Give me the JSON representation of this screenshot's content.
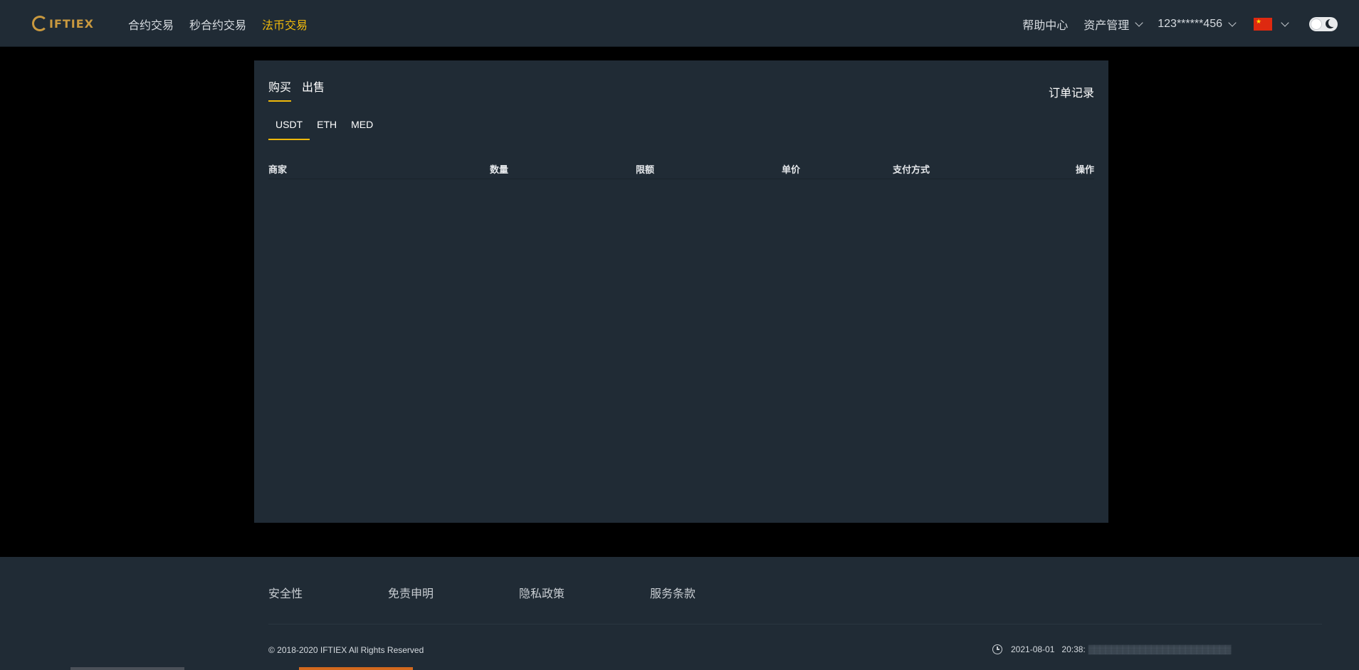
{
  "header": {
    "logo_text": "IFTIEX",
    "nav": [
      {
        "label": "合约交易",
        "active": false
      },
      {
        "label": "秒合约交易",
        "active": false
      },
      {
        "label": "法币交易",
        "active": true
      }
    ],
    "help_center": "帮助中心",
    "asset_management": "资产管理",
    "account": "123******456",
    "language_flag": "cn-flag-icon",
    "theme_toggle": "dark-mode-toggle"
  },
  "main": {
    "trade_tabs": [
      {
        "label": "购买",
        "active": true
      },
      {
        "label": "出售",
        "active": false
      }
    ],
    "order_record": "订单记录",
    "coin_tabs": [
      {
        "label": "USDT",
        "active": true
      },
      {
        "label": "ETH",
        "active": false
      },
      {
        "label": "MED",
        "active": false
      }
    ],
    "table": {
      "columns": [
        "商家",
        "数量",
        "限额",
        "单价",
        "支付方式",
        "操作"
      ],
      "rows": []
    }
  },
  "footer": {
    "links": [
      "安全性",
      "免责申明",
      "隐私政策",
      "服务条款"
    ],
    "copyright": "© 2018-2020 IFTIEX All Rights Reserved",
    "date": "2021-08-01",
    "time": "20:38:"
  },
  "colors": {
    "accent": "#f0b90b",
    "panel_bg": "#202b35",
    "page_bg": "#000000"
  }
}
